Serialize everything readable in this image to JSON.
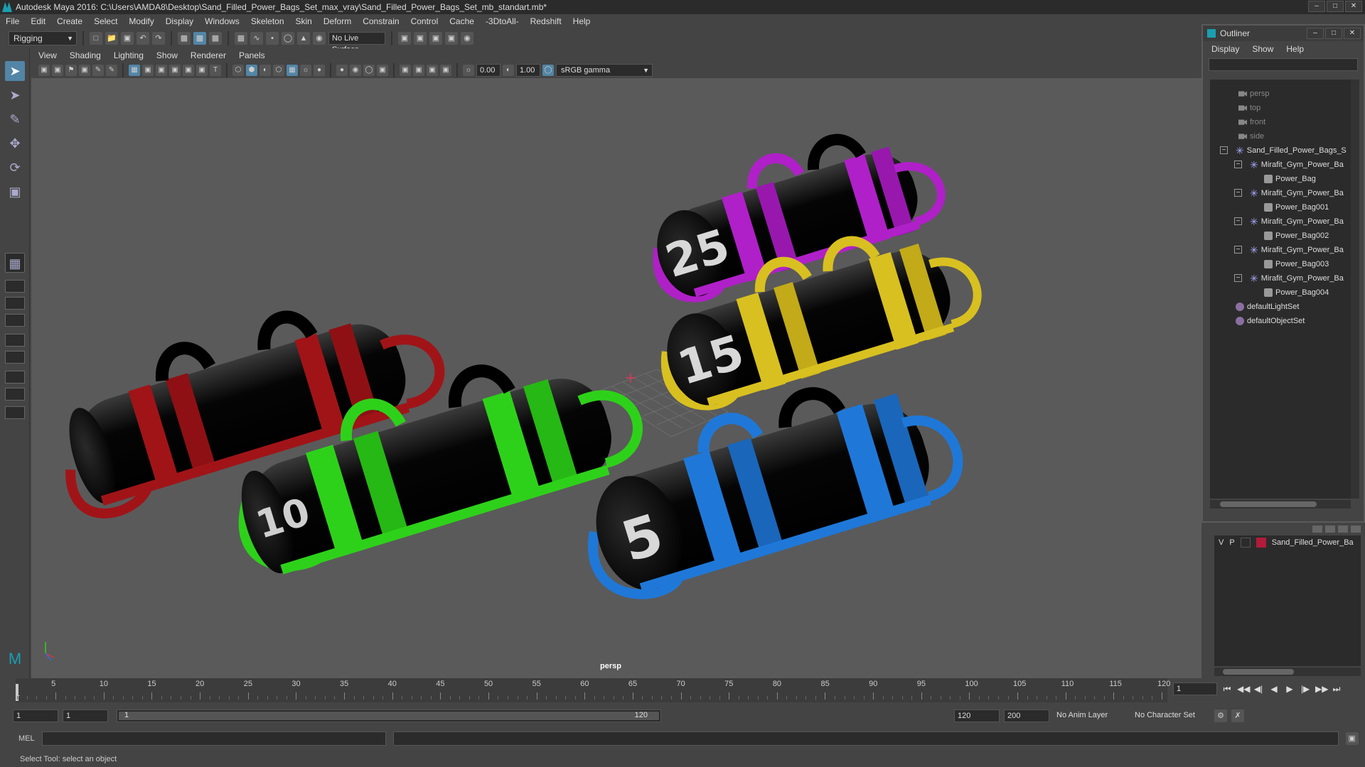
{
  "window": {
    "title": "Autodesk Maya 2016: C:\\Users\\AMDA8\\Desktop\\Sand_Filled_Power_Bags_Set_max_vray\\Sand_Filled_Power_Bags_Set_mb_standart.mb*"
  },
  "menus": [
    "File",
    "Edit",
    "Create",
    "Select",
    "Modify",
    "Display",
    "Windows",
    "Skeleton",
    "Skin",
    "Deform",
    "Constrain",
    "Control",
    "Cache",
    "-3DtoAll-",
    "Redshift",
    "Help"
  ],
  "shelf": {
    "mode": "Rigging",
    "live_surface": "No Live Surface"
  },
  "panel_menus": [
    "View",
    "Shading",
    "Lighting",
    "Show",
    "Renderer",
    "Panels"
  ],
  "viewport_toolbar": {
    "exposure": "0.00",
    "gamma": "1.00",
    "color_space": "sRGB gamma"
  },
  "viewport": {
    "camera_label": "persp",
    "bag_labels": [
      "25",
      "15",
      "5"
    ]
  },
  "outliner": {
    "title": "Outliner",
    "menus": [
      "Display",
      "Show",
      "Help"
    ],
    "items": [
      {
        "label": "persp",
        "type": "camera",
        "indent": 0
      },
      {
        "label": "top",
        "type": "camera",
        "indent": 0
      },
      {
        "label": "front",
        "type": "camera",
        "indent": 0
      },
      {
        "label": "side",
        "type": "camera",
        "indent": 0
      },
      {
        "label": "Sand_Filled_Power_Bags_S",
        "type": "group",
        "indent": 0
      },
      {
        "label": "Mirafit_Gym_Power_Ba",
        "type": "group",
        "indent": 1
      },
      {
        "label": "Power_Bag",
        "type": "mesh",
        "indent": 2
      },
      {
        "label": "Mirafit_Gym_Power_Ba",
        "type": "group",
        "indent": 1
      },
      {
        "label": "Power_Bag001",
        "type": "mesh",
        "indent": 2
      },
      {
        "label": "Mirafit_Gym_Power_Ba",
        "type": "group",
        "indent": 1
      },
      {
        "label": "Power_Bag002",
        "type": "mesh",
        "indent": 2
      },
      {
        "label": "Mirafit_Gym_Power_Ba",
        "type": "group",
        "indent": 1
      },
      {
        "label": "Power_Bag003",
        "type": "mesh",
        "indent": 2
      },
      {
        "label": "Mirafit_Gym_Power_Ba",
        "type": "group",
        "indent": 1
      },
      {
        "label": "Power_Bag004",
        "type": "mesh",
        "indent": 2
      },
      {
        "label": "defaultLightSet",
        "type": "set",
        "indent": 0
      },
      {
        "label": "defaultObjectSet",
        "type": "set",
        "indent": 0
      }
    ]
  },
  "layers": {
    "visible": "V",
    "playback": "P",
    "layer_name": "Sand_Filled_Power_Ba",
    "layer_color": "#b01c3a"
  },
  "timeline": {
    "ticks": [
      "1",
      "5",
      "10",
      "15",
      "20",
      "25",
      "30",
      "35",
      "40",
      "45",
      "50",
      "55",
      "60",
      "65",
      "70",
      "75",
      "80",
      "85",
      "90",
      "95",
      "100",
      "105",
      "110",
      "115",
      "120"
    ],
    "current_frame": "1",
    "range_start": "1",
    "range_end": "120"
  },
  "range": {
    "start_a": "1",
    "start_b": "1",
    "bar_start": "1",
    "bar_end": "120",
    "end_a": "120",
    "end_b": "200",
    "anim_layer": "No Anim Layer",
    "char_set": "No Character Set"
  },
  "command_line": {
    "lang": "MEL"
  },
  "status": {
    "text": "Select Tool: select an object"
  },
  "colors": {
    "red": "#a01418",
    "green": "#2ed11a",
    "purple": "#b020c8",
    "yellow": "#d8c020",
    "blue": "#1f78d8"
  }
}
